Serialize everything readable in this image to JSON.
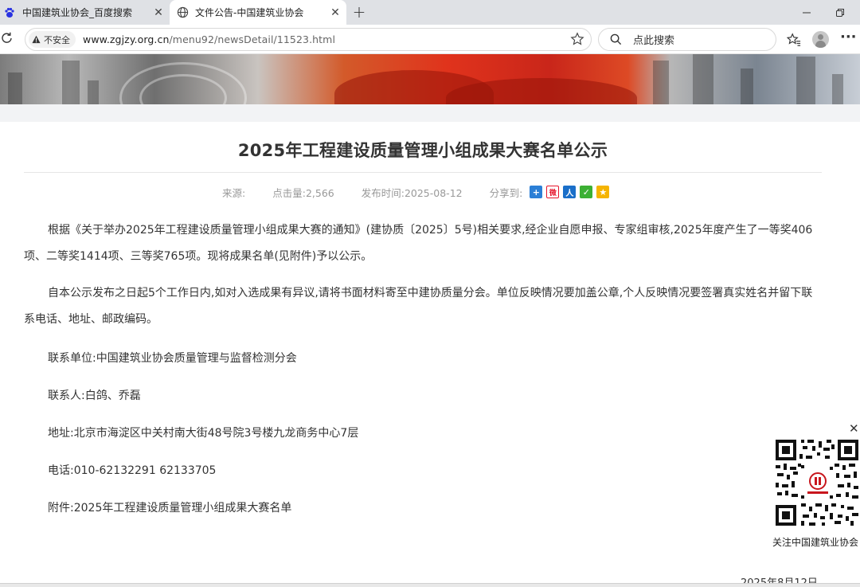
{
  "browser": {
    "tabs": [
      {
        "label": "中国建筑业协会_百度搜索",
        "favicon": "baidu-paw-icon",
        "active": false
      },
      {
        "label": "文件公告-中国建筑业协会",
        "favicon": "globe-icon",
        "active": true
      }
    ],
    "security_label": "不安全",
    "url_host": "www.zgjzy.org.cn",
    "url_path": "/menu92/newsDetail/11523.html",
    "search_placeholder": "点此搜索"
  },
  "article": {
    "title": "2025年工程建设质量管理小组成果大赛名单公示",
    "meta": {
      "source_label": "来源:",
      "views_label": "点击量:",
      "views": "2,566",
      "published_label": "发布时间:",
      "published": "2025-08-12",
      "share_label": "分享到:"
    },
    "share_icons": [
      {
        "name": "share-more-icon",
        "color": "#2b7fd6",
        "glyph": "+"
      },
      {
        "name": "weibo-icon",
        "color": "#e6162d",
        "glyph": "微"
      },
      {
        "name": "renren-icon",
        "color": "#1a6fc9",
        "glyph": "人"
      },
      {
        "name": "wechat-icon",
        "color": "#3cb034",
        "glyph": "✓"
      },
      {
        "name": "qzone-icon",
        "color": "#f5b400",
        "glyph": "★"
      }
    ],
    "paragraph_1": "根据《关于举办2025年工程建设质量管理小组成果大赛的通知》(建协质〔2025〕5号)相关要求,经企业自愿申报、专家组审核,2025年度产生了一等奖406项、二等奖1414项、三等奖765项。现将成果名单(见附件)予以公示。",
    "paragraph_2": "自本公示发布之日起5个工作日内,如对入选成果有异议,请将书面材料寄至中建协质量分会。单位反映情况要加盖公章,个人反映情况要签署真实姓名并留下联系电话、地址、邮政编码。",
    "contact_unit": "联系单位:中国建筑业协会质量管理与监督检测分会",
    "contact_person": "联系人:白鸽、乔磊",
    "address": "地址:北京市海淀区中关村南大街48号院3号楼九龙商务中心7层",
    "phone": "电话:010-62132291 62133705",
    "attachment": "附件:2025年工程建设质量管理小组成果大赛名单",
    "date_signature": "2025年8月12日"
  },
  "qr_widget": {
    "caption": "关注中国建筑业协会"
  }
}
